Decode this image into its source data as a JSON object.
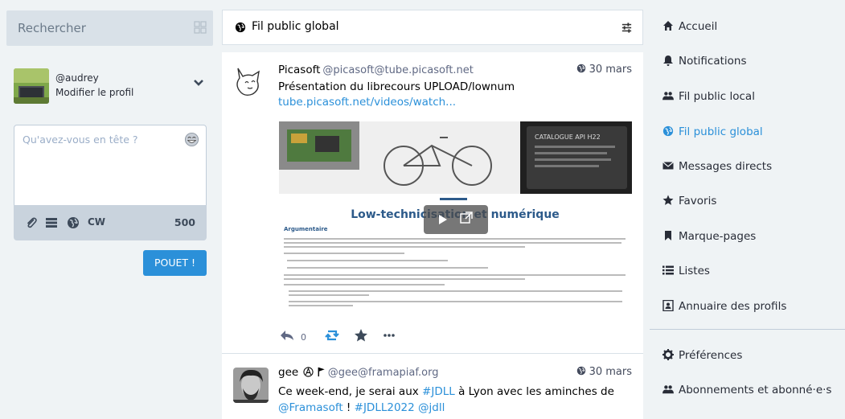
{
  "search": {
    "placeholder": "Rechercher"
  },
  "profile": {
    "handle": "@audrey",
    "edit_label": "Modifier le profil"
  },
  "compose": {
    "placeholder": "Qu'avez-vous en tête ?",
    "cw_label": "CW",
    "counter": "500",
    "submit_label": "POUET !"
  },
  "column": {
    "title": "Fil public global"
  },
  "statuses": [
    {
      "display_name": "Picasoft",
      "acct": "@picasoft@tube.picasoft.net",
      "time": "30 mars",
      "text": "Présentation du librecours UPLOAD/lownum",
      "link": "tube.picasoft.net/videos/watch...",
      "video": {
        "title": "Low-technicisation et numérique",
        "section": "Argumentaire",
        "card_label": "CATALOGUE API H22"
      },
      "replies": "0"
    },
    {
      "display_name": "gee",
      "acct": "@gee@framapiaf.org",
      "time": "30 mars",
      "text_parts": [
        "Ce week-end, je serai aux ",
        "#JDLL",
        " à Lyon avec les aminches de ",
        "@Framasoft",
        " ! ",
        "#JDLL2022",
        " ",
        "@jdll"
      ]
    }
  ],
  "nav": [
    {
      "label": "Accueil",
      "icon": "home-icon"
    },
    {
      "label": "Notifications",
      "icon": "bell-icon"
    },
    {
      "label": "Fil public local",
      "icon": "users-icon"
    },
    {
      "label": "Fil public global",
      "icon": "globe-icon",
      "active": true
    },
    {
      "label": "Messages directs",
      "icon": "envelope-icon"
    },
    {
      "label": "Favoris",
      "icon": "star-icon"
    },
    {
      "label": "Marque-pages",
      "icon": "bookmark-icon"
    },
    {
      "label": "Listes",
      "icon": "list-icon"
    },
    {
      "label": "Annuaire des profils",
      "icon": "address-book-icon"
    },
    {
      "label": "Préférences",
      "icon": "gear-icon"
    },
    {
      "label": "Abonnements et abonné·e·s",
      "icon": "users-icon"
    }
  ],
  "colors": {
    "accent": "#2b90d9",
    "background": "#eff3f5",
    "text": "#282c37"
  }
}
